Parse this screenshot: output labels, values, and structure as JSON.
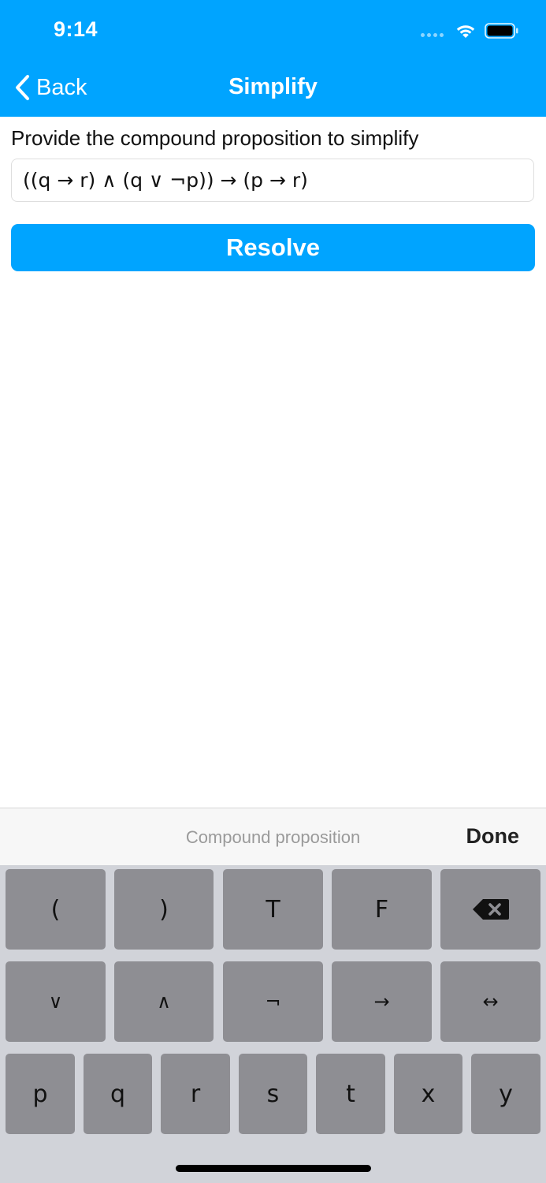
{
  "status_bar": {
    "time": "9:14"
  },
  "nav": {
    "back_label": "Back",
    "title": "Simplify"
  },
  "content": {
    "prompt": "Provide the compound proposition to simplify",
    "expression_value": "((q → r) ∧ (q ∨ ¬p)) → (p → r)",
    "resolve_label": "Resolve"
  },
  "accessory": {
    "placeholder": "Compound proposition",
    "done_label": "Done"
  },
  "keyboard": {
    "row1": [
      "(",
      ")",
      "T",
      "F"
    ],
    "row2": [
      "∨",
      "∧",
      "¬",
      "→",
      "↔"
    ],
    "row3": [
      "p",
      "q",
      "r",
      "s",
      "t",
      "x",
      "y"
    ],
    "delete_icon": "delete-backspace-icon"
  },
  "colors": {
    "accent": "#00A4FF",
    "key": "#8E8E93",
    "keyboard_bg": "#D1D3D9"
  }
}
